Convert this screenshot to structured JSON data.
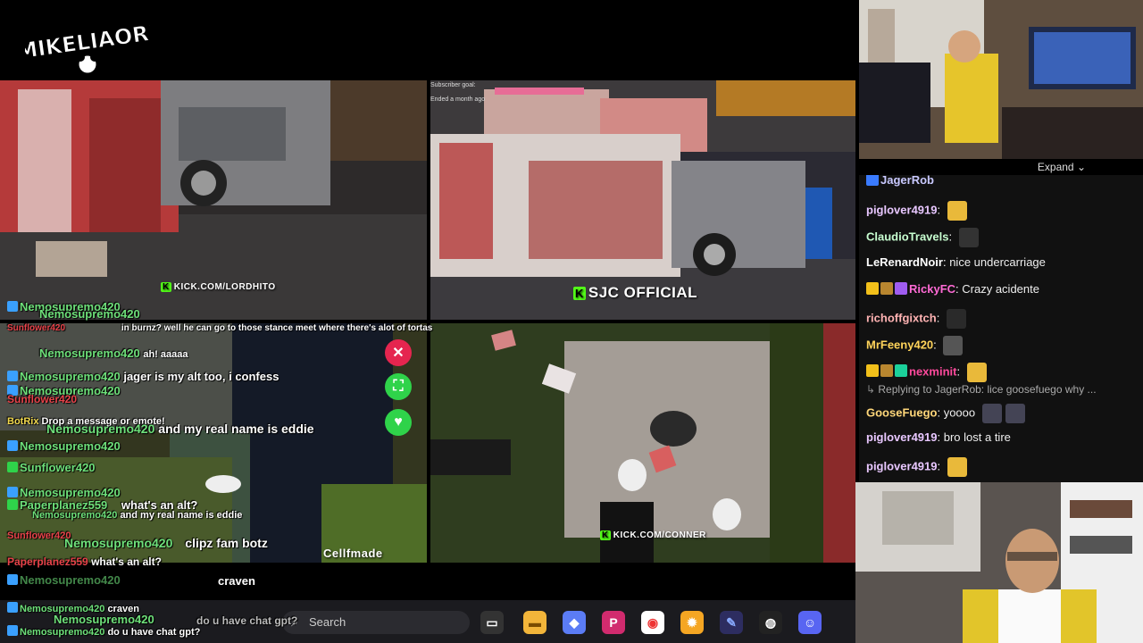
{
  "logo": {
    "text": "MIKELIAORI"
  },
  "tiles": {
    "top_left": {
      "watermark": "KICK.COM/LORDHITO",
      "faded_text": "Nemosupremo420"
    },
    "top_right": {
      "watermark": "SJC OFFICIAL",
      "subscriber_goal": "Subscriber goal:",
      "ended": "Ended a month ago"
    },
    "bottom_left": {
      "watermark": "Cellfmade"
    },
    "bottom_right": {
      "watermark": "KICK.COM/CONNER"
    }
  },
  "overlay_chat": [
    {
      "user": "Nemosupremo420",
      "msg": ""
    },
    {
      "user": "Nemosupremo420",
      "msg": ""
    },
    {
      "user": "Sunflower420",
      "msg": "in burnz? well he can go to those stance meet where there's alot of tortas",
      "red": true
    },
    {
      "user": "Nemosupremo420",
      "msg": "ah! aaaaa"
    },
    {
      "user": "Nemosupremo420",
      "msg": "jager is my alt too, i confess"
    },
    {
      "user": "Nemosupremo420",
      "msg": ""
    },
    {
      "user": "Sunflower420",
      "msg": "",
      "red": true
    },
    {
      "user": "BotRix",
      "msg": "Drop a message or emote!"
    },
    {
      "user": "Nemosupremo420",
      "msg": "and my real name is eddie"
    },
    {
      "user": "Nemosupremo420",
      "msg": ""
    },
    {
      "user": "Sunflower420",
      "msg": ""
    },
    {
      "user": "Nemosupremo420",
      "msg": ""
    },
    {
      "user": "Paperplanez559",
      "msg": "what's an alt?"
    },
    {
      "user": "Nemosupremo420",
      "msg": "and my real name is eddie"
    },
    {
      "user": "Sunflower420",
      "msg": "",
      "red": true
    },
    {
      "user": "Nemosupremo420",
      "msg": "clipz fam botz"
    },
    {
      "user": "Paperplanez559",
      "msg": "what's an alt?",
      "red": true
    },
    {
      "user": "Nemosupremo420",
      "msg": "clipz fam botz"
    },
    {
      "user": "",
      "msg": "craven"
    },
    {
      "user": "Nemosupremo420",
      "msg": "craven"
    },
    {
      "user": "Nemosupremo420",
      "msg": "do u have chat gpt?"
    },
    {
      "user": "Nemosupremo420",
      "msg": "do u have chat gpt?"
    }
  ],
  "chat_panel": {
    "expand_label": "Expand",
    "messages": [
      {
        "name": "JagerRob",
        "text": "",
        "color": "#c9c9ff"
      },
      {
        "name": "piglover4919",
        "text": "",
        "color": "#e8c7ff"
      },
      {
        "name": "ClaudioTravels",
        "text": "",
        "color": "#c8ffd1"
      },
      {
        "name": "LeRenardNoir",
        "text": "nice undercarriage",
        "color": "#ffffff"
      },
      {
        "name": "RickyFC",
        "text": "Crazy acidente",
        "color": "#ff6ad5"
      },
      {
        "name": "richoffgixtch",
        "text": "",
        "color": "#ffb3b3"
      },
      {
        "name": "MrFeeny420",
        "text": "",
        "color": "#ffd45a"
      },
      {
        "name": "nexminit",
        "text": "",
        "color": "#ff4a9d"
      },
      {
        "name": "Replying to JagerRob:",
        "text": "lice goosefuego why ...",
        "color": "#aaaaaa"
      },
      {
        "name": "GooseFuego",
        "text": "yoooo",
        "color": "#ffd77a"
      },
      {
        "name": "piglover4919",
        "text": "bro lost a tire",
        "color": "#e8c7ff"
      },
      {
        "name": "piglover4919",
        "text": "",
        "color": "#e8c7ff"
      }
    ]
  },
  "taskbar": {
    "search_placeholder": "Search"
  },
  "colors": {
    "kick_green": "#53fc18",
    "close_red": "#e5254f",
    "heart_green": "#2fd34a"
  }
}
